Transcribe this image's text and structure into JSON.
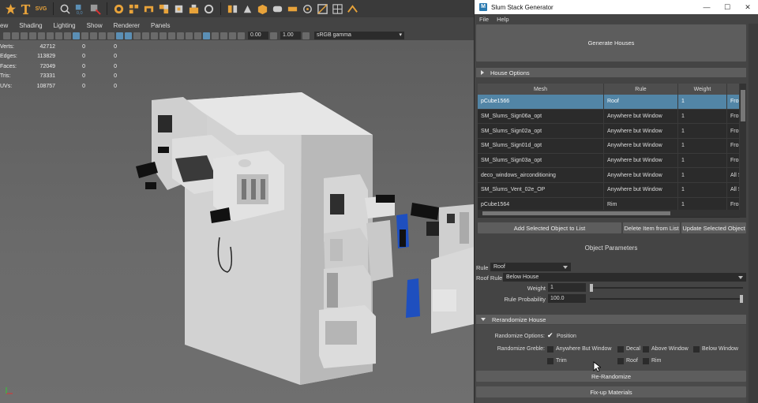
{
  "maya": {
    "shelf_text_icon": "SVG",
    "viewport_menu": [
      "ew",
      "Shading",
      "Lighting",
      "Show",
      "Renderer",
      "Panels"
    ],
    "exposure": "0.00",
    "gamma": "1.00",
    "color_space": "sRGB gamma",
    "hud": [
      {
        "label": "Verts:",
        "v1": "42712",
        "v2": "0",
        "v3": "0"
      },
      {
        "label": "Edges:",
        "v1": "113829",
        "v2": "0",
        "v3": "0"
      },
      {
        "label": "Faces:",
        "v1": "72049",
        "v2": "0",
        "v3": "0"
      },
      {
        "label": "Tris:",
        "v1": "73331",
        "v2": "0",
        "v3": "0"
      },
      {
        "label": "UVs:",
        "v1": "108757",
        "v2": "0",
        "v3": "0"
      }
    ]
  },
  "window": {
    "app_icon": "M",
    "title": "Slum Stack Generator",
    "controls": {
      "minimize": "—",
      "maximize": "☐",
      "close": "✕"
    },
    "menu": [
      "File",
      "Help"
    ],
    "generate_button": "Generate Houses",
    "house_options_header": "House Options",
    "table": {
      "columns": [
        "Mesh",
        "Rule",
        "Weight",
        ""
      ],
      "rows": [
        {
          "mesh": "pCube1566",
          "rule": "Roof",
          "weight": "1",
          "extra": "Fron",
          "selected": true
        },
        {
          "mesh": "SM_Slums_Sign06a_opt",
          "rule": "Anywhere but Window",
          "weight": "1",
          "extra": "Fron",
          "selected": false
        },
        {
          "mesh": "SM_Slums_Sign02a_opt",
          "rule": "Anywhere but Window",
          "weight": "1",
          "extra": "Fron",
          "selected": false
        },
        {
          "mesh": "SM_Slums_Sign01d_opt",
          "rule": "Anywhere but Window",
          "weight": "1",
          "extra": "Fron",
          "selected": false
        },
        {
          "mesh": "SM_Slums_Sign03a_opt",
          "rule": "Anywhere but Window",
          "weight": "1",
          "extra": "Fron",
          "selected": false
        },
        {
          "mesh": "deco_windows_airconditioning",
          "rule": "Anywhere but Window",
          "weight": "1",
          "extra": "All Si",
          "selected": false
        },
        {
          "mesh": "SM_Slums_Vent_02e_OP",
          "rule": "Anywhere but Window",
          "weight": "1",
          "extra": "All Si",
          "selected": false
        },
        {
          "mesh": "pCube1564",
          "rule": "Rim",
          "weight": "1",
          "extra": "Fron",
          "selected": false
        }
      ]
    },
    "buttons": {
      "add_selected": "Add Selected Object to List",
      "delete_item": "Delete Item from List",
      "update_selected": "Update Selected Object"
    },
    "object_parameters": {
      "header": "Object Parameters",
      "rule_label": "Rule",
      "rule_value": "Roof",
      "roof_rule_label": "Roof Rule",
      "roof_rule_value": "Below House",
      "weight_label": "Weight",
      "weight_value": "1",
      "weight_slider": 0.0,
      "probability_label": "Rule Probability",
      "probability_value": "100.0",
      "probability_slider": 1.0
    },
    "rerandomize": {
      "header": "Rerandomize House",
      "options_label": "Randomize Options:",
      "position_label": "Position",
      "position_checked": true,
      "greble_label": "Randomize Greble:",
      "greble_options": [
        "Anywhere But Window",
        "Decal",
        "Above Window",
        "Below Window",
        "Trim",
        "Roof",
        "Rim"
      ],
      "rerandomize_button": "Re-Randomize",
      "fixup_button": "Fix-up Materials"
    }
  }
}
